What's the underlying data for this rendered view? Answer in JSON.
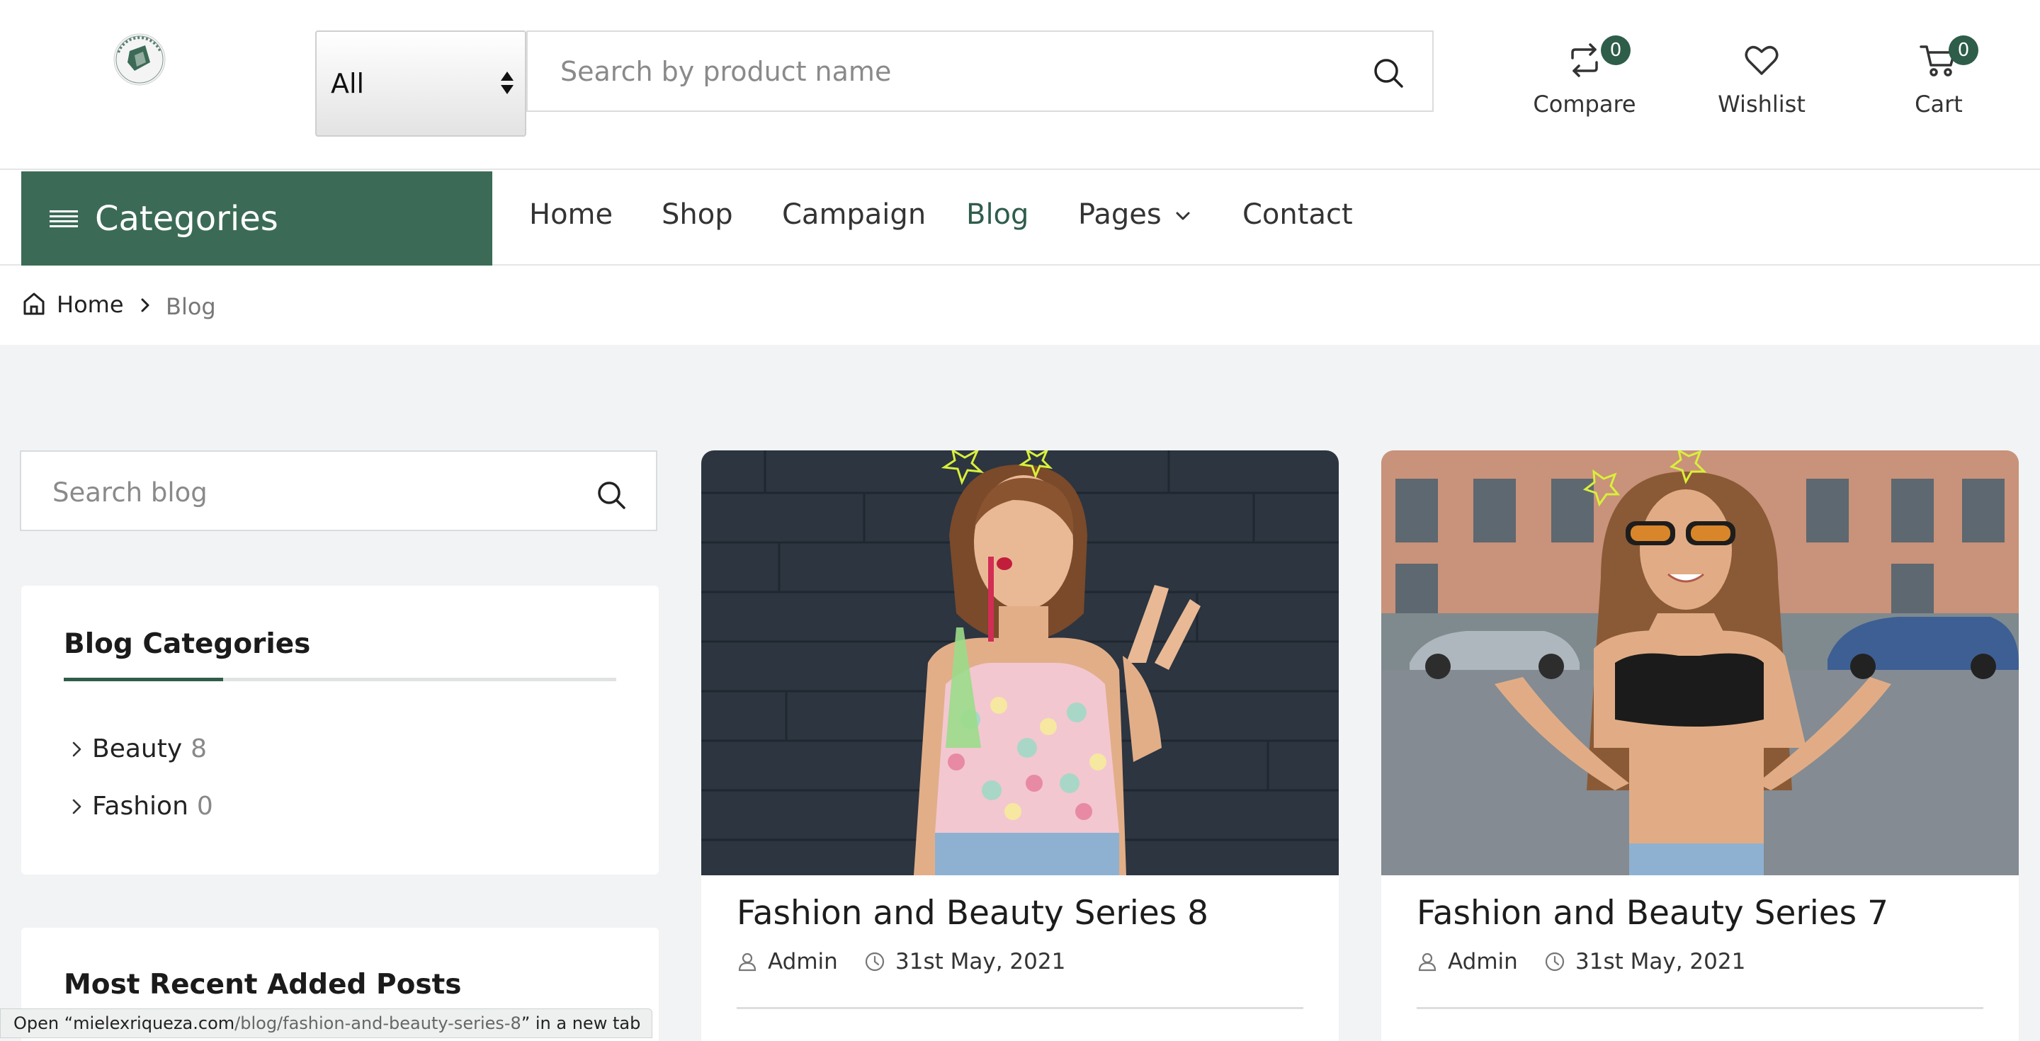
{
  "header": {
    "category_select": {
      "value": "All"
    },
    "search": {
      "placeholder": "Search by product name"
    },
    "compare": {
      "label": "Compare",
      "count": "0"
    },
    "wishlist": {
      "label": "Wishlist"
    },
    "cart": {
      "label": "Cart",
      "count": "0"
    }
  },
  "nav": {
    "categories_label": "Categories",
    "links": [
      {
        "label": "Home"
      },
      {
        "label": "Shop"
      },
      {
        "label": "Campaign"
      },
      {
        "label": "Blog",
        "active": true
      },
      {
        "label": "Pages",
        "has_dropdown": true
      },
      {
        "label": "Contact"
      }
    ]
  },
  "breadcrumb": {
    "home": "Home",
    "current": "Blog"
  },
  "sidebar": {
    "search_placeholder": "Search blog",
    "categories_title": "Blog Categories",
    "categories": [
      {
        "name": "Beauty",
        "count": "8"
      },
      {
        "name": "Fashion",
        "count": "0"
      }
    ],
    "recent_title": "Most Recent Added Posts"
  },
  "posts": [
    {
      "title": "Fashion and Beauty Series 8",
      "author": "Admin",
      "date": "31st May, 2021"
    },
    {
      "title": "Fashion and Beauty Series 7",
      "author": "Admin",
      "date": "31st May, 2021"
    }
  ],
  "status_bar": {
    "prefix": "Open “mielexriqueza.com",
    "path": "/blog/fashion-and-beauty-series-8",
    "suffix": "” in a new tab"
  },
  "colors": {
    "brand_green": "#3b6b56",
    "badge_green": "#2e5d4a",
    "content_bg": "#f1f3f4"
  }
}
